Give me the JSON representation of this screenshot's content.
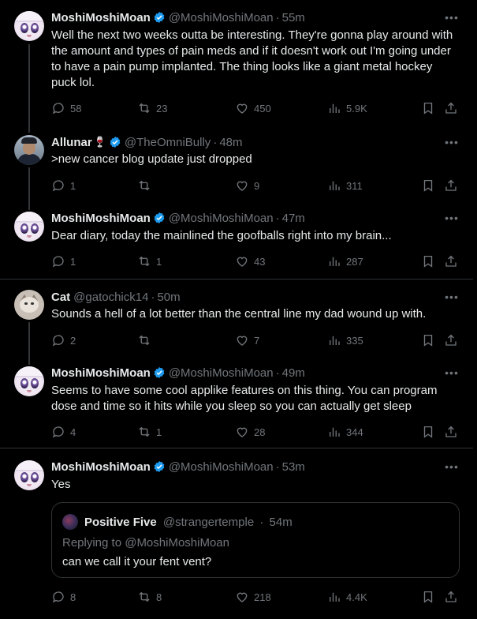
{
  "icons": {
    "reply": "reply-icon",
    "retweet": "retweet-icon",
    "like": "heart-icon",
    "views": "views-icon",
    "bookmark": "bookmark-icon",
    "share": "share-icon",
    "more": "more-icon",
    "verified": "verified-badge-icon"
  },
  "colors": {
    "background": "#000000",
    "text": "#e7e9ea",
    "muted": "#71767b",
    "verified": "#1d9bf0",
    "border": "#2f3336"
  },
  "posts": [
    {
      "name": "MoshiMoshiMoan",
      "handle": "@MoshiMoshiMoan",
      "sep": "·",
      "time": "55m",
      "text": "Well the next two weeks outta be interesting.  They're gonna play around with the amount and types of pain meds and if it doesn't work out I'm going under to have a pain pump implanted.  The thing looks like a giant metal hockey puck lol.",
      "replies": "58",
      "retweets": "23",
      "likes": "450",
      "views": "5.9K"
    },
    {
      "name": "Allunar",
      "emoji": "🍷",
      "handle": "@TheOmniBully",
      "sep": "·",
      "time": "48m",
      "text": ">new cancer blog update just dropped",
      "replies": "1",
      "retweets": "",
      "likes": "9",
      "views": "311"
    },
    {
      "name": "MoshiMoshiMoan",
      "handle": "@MoshiMoshiMoan",
      "sep": "·",
      "time": "47m",
      "text": "Dear diary, today the mainlined the goofballs right into my brain...",
      "replies": "1",
      "retweets": "1",
      "likes": "43",
      "views": "287"
    },
    {
      "name": "Cat",
      "handle": "@gatochick14",
      "sep": "·",
      "time": "50m",
      "text": "Sounds a hell of a lot better than the central line my dad wound up with.",
      "replies": "2",
      "retweets": "",
      "likes": "7",
      "views": "335"
    },
    {
      "name": "MoshiMoshiMoan",
      "handle": "@MoshiMoshiMoan",
      "sep": "·",
      "time": "49m",
      "text": "Seems to have some cool applike features on this thing.  You can program dose and time so it hits while you sleep so you can actually get sleep",
      "replies": "4",
      "retweets": "1",
      "likes": "28",
      "views": "344"
    },
    {
      "name": "MoshiMoshiMoan",
      "handle": "@MoshiMoshiMoan",
      "sep": "·",
      "time": "53m",
      "text": "Yes",
      "replies": "8",
      "retweets": "8",
      "likes": "218",
      "views": "4.4K",
      "quote": {
        "name": "Positive Five",
        "handle": "@strangertemple",
        "sep": "·",
        "time": "54m",
        "replying_to": "Replying to @MoshiMoshiMoan",
        "text": "can we call it your fent vent?"
      }
    }
  ]
}
